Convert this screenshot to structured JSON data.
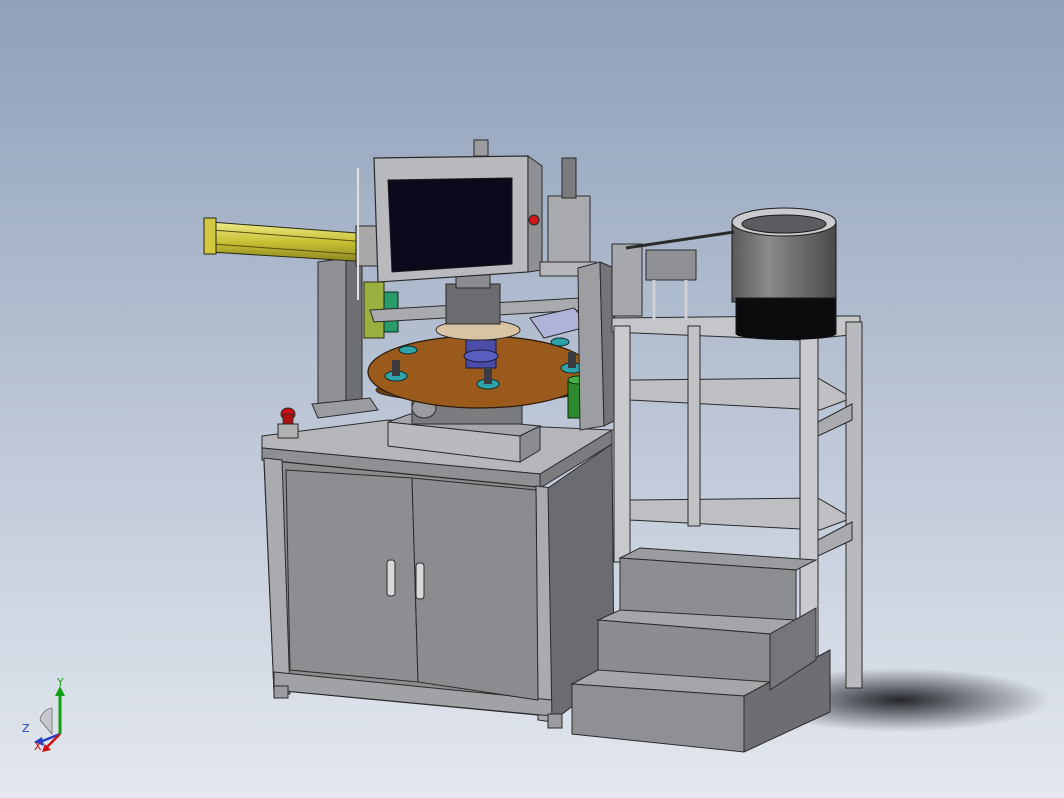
{
  "viewport": {
    "background_top": "#8fa0ba",
    "background_bottom": "#e4e8ef"
  },
  "model": {
    "frame_color": "#c4c6c9",
    "cabinet_color": "#8a8c8e",
    "turntable_color": "#9a5a1c",
    "cylinder_color": "#d8d04a",
    "fixture_color": "#2fa3a8",
    "screen_color": "#0a0a1c",
    "estop_color": "#cc1111"
  },
  "triad": {
    "x_label": "X",
    "y_label": "Y",
    "z_label": "Z",
    "x_color": "#d01010",
    "y_color": "#10a010",
    "z_color": "#2040d0"
  }
}
